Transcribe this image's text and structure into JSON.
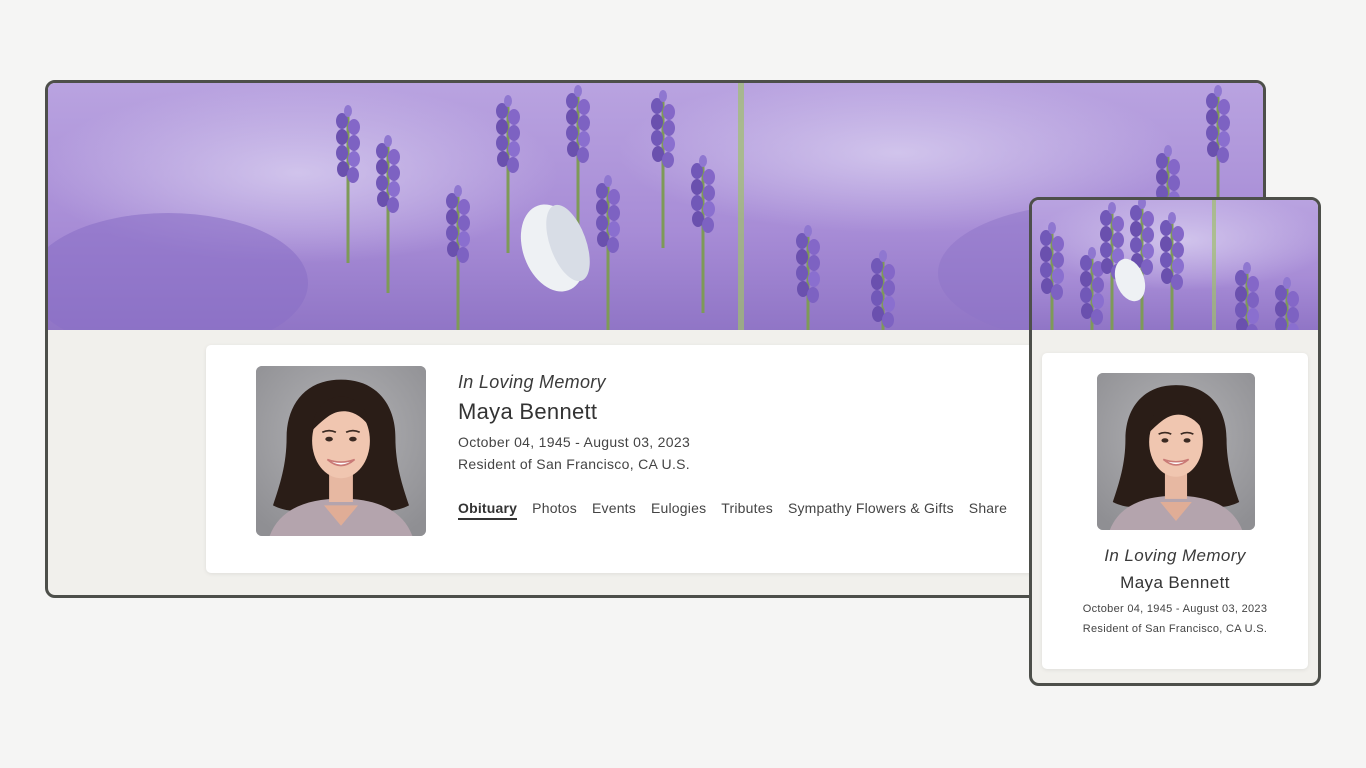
{
  "colors": {
    "page_background": "#f5f5f4",
    "frame_border": "#4d4f4a",
    "content_background": "#f1f0ec",
    "card_background": "#ffffff",
    "lavender": "#9a7fd0",
    "text": "#3a3a3a"
  },
  "banner": {
    "image": "lavender-field-with-white-butterfly"
  },
  "profile": {
    "photo": "portrait-woman-curly-hair-smiling",
    "memory_label": "In Loving Memory",
    "name": "Maya Bennett",
    "dates": "October 04, 1945 - August 03, 2023",
    "residence": "Resident of San Francisco, CA U.S."
  },
  "nav": {
    "items": [
      {
        "label": "Obituary",
        "active": true
      },
      {
        "label": "Photos",
        "active": false
      },
      {
        "label": "Events",
        "active": false
      },
      {
        "label": "Eulogies",
        "active": false
      },
      {
        "label": "Tributes",
        "active": false
      },
      {
        "label": "Sympathy Flowers & Gifts",
        "active": false
      },
      {
        "label": "Share",
        "active": false
      }
    ]
  }
}
